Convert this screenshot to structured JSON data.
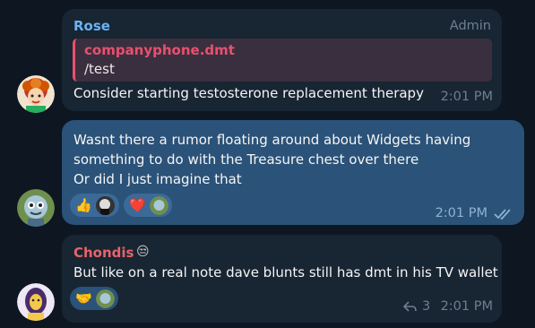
{
  "messages": [
    {
      "sender": "Rose",
      "role": "Admin",
      "reply_to": {
        "author": "companyphone.dmt",
        "text": "/test"
      },
      "text": "Consider starting testosterone replacement therapy",
      "time": "2:01 PM",
      "colors": {
        "name": "#6ab3f3"
      }
    },
    {
      "lines": [
        "Wasnt there a rumor floating around about Widgets having",
        "something to do with  the Treasure chest over there",
        "Or did I just imagine that"
      ],
      "reactions": [
        {
          "emoji": "👍",
          "icon": "thumbs-up-icon"
        },
        {
          "emoji": "❤️",
          "icon": "heart-icon"
        }
      ],
      "time": "2:01 PM",
      "status_icon": "double-check-icon"
    },
    {
      "sender": "Chondis",
      "sender_emoji": "😒",
      "text": "But like on a real note dave blunts still has dmt in his TV wallet",
      "reactions": [
        {
          "emoji": "🤝",
          "icon": "handshake-icon"
        }
      ],
      "replies": "3",
      "time": "2:01 PM",
      "colors": {
        "name": "#e8636a"
      }
    }
  ]
}
